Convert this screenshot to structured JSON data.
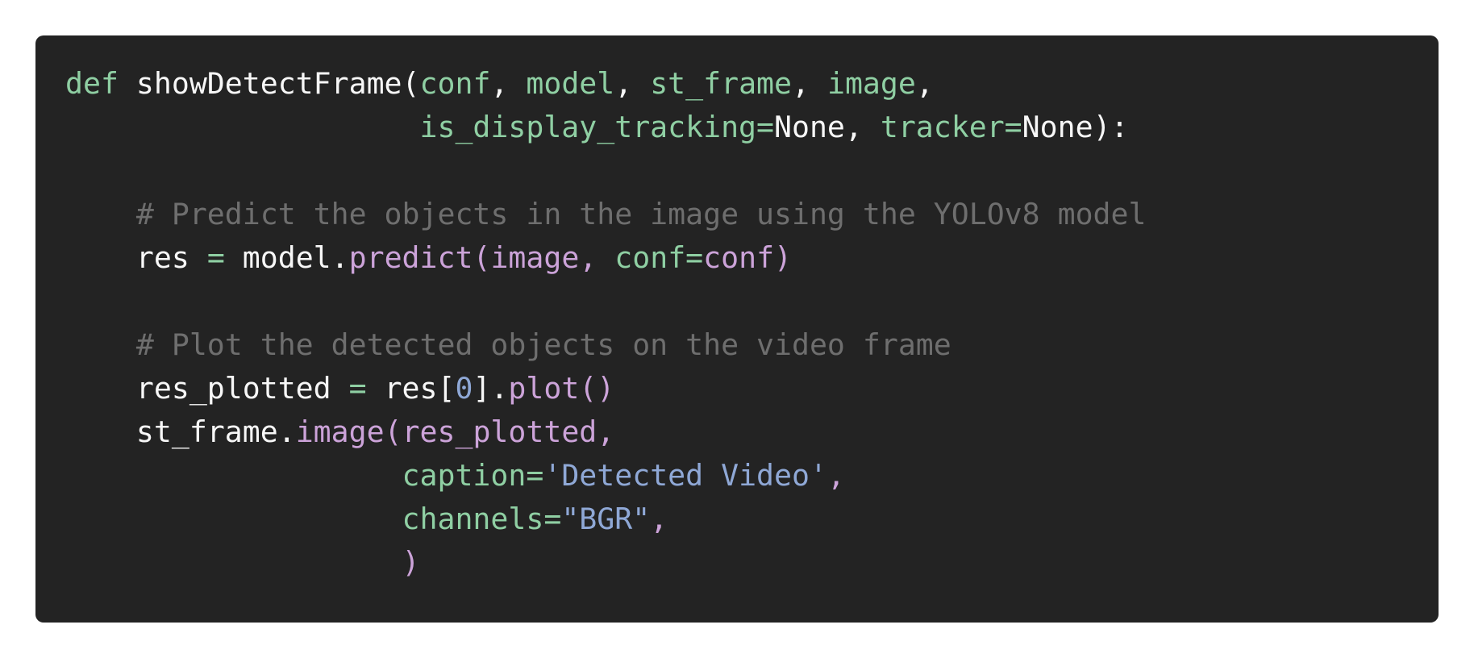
{
  "code": {
    "language": "python",
    "colors": {
      "background": "#232323",
      "keyword": "#8fcfa3",
      "plain": "#f7f7f7",
      "comment": "#6e6e6e",
      "call": "#cca3d9",
      "literal": "#8fa8d6"
    },
    "lines": [
      [
        {
          "t": "def",
          "c": "kw"
        },
        {
          "t": " showDetectFrame(",
          "c": "plain"
        },
        {
          "t": "conf",
          "c": "param"
        },
        {
          "t": ", ",
          "c": "plain"
        },
        {
          "t": "model",
          "c": "param"
        },
        {
          "t": ", ",
          "c": "plain"
        },
        {
          "t": "st_frame",
          "c": "param"
        },
        {
          "t": ", ",
          "c": "plain"
        },
        {
          "t": "image",
          "c": "param"
        },
        {
          "t": ",",
          "c": "plain"
        }
      ],
      [
        {
          "t": "                    ",
          "c": "plain"
        },
        {
          "t": "is_display_tracking=",
          "c": "param"
        },
        {
          "t": "None",
          "c": "plain"
        },
        {
          "t": ", ",
          "c": "plain"
        },
        {
          "t": "tracker=",
          "c": "param"
        },
        {
          "t": "None",
          "c": "plain"
        },
        {
          "t": "):",
          "c": "plain"
        }
      ],
      [],
      [
        {
          "t": "    # Predict the objects in the image using the YOLOv8 model",
          "c": "comment"
        }
      ],
      [
        {
          "t": "    res ",
          "c": "plain"
        },
        {
          "t": "=",
          "c": "op"
        },
        {
          "t": " model.",
          "c": "plain"
        },
        {
          "t": "predict(",
          "c": "call"
        },
        {
          "t": "image",
          "c": "call"
        },
        {
          "t": ", ",
          "c": "call"
        },
        {
          "t": "conf=",
          "c": "param"
        },
        {
          "t": "conf)",
          "c": "call"
        }
      ],
      [],
      [
        {
          "t": "    # Plot the detected objects on the video frame",
          "c": "comment"
        }
      ],
      [
        {
          "t": "    res_plotted ",
          "c": "plain"
        },
        {
          "t": "=",
          "c": "op"
        },
        {
          "t": " res[",
          "c": "plain"
        },
        {
          "t": "0",
          "c": "num"
        },
        {
          "t": "].",
          "c": "plain"
        },
        {
          "t": "plot()",
          "c": "call"
        }
      ],
      [
        {
          "t": "    st_frame.",
          "c": "plain"
        },
        {
          "t": "image(",
          "c": "call"
        },
        {
          "t": "res_plotted,",
          "c": "call"
        }
      ],
      [
        {
          "t": "                   ",
          "c": "plain"
        },
        {
          "t": "caption=",
          "c": "param"
        },
        {
          "t": "'Detected Video'",
          "c": "str"
        },
        {
          "t": ",",
          "c": "call"
        }
      ],
      [
        {
          "t": "                   ",
          "c": "plain"
        },
        {
          "t": "channels=",
          "c": "param"
        },
        {
          "t": "\"BGR\"",
          "c": "str"
        },
        {
          "t": ",",
          "c": "call"
        }
      ],
      [
        {
          "t": "                   ",
          "c": "plain"
        },
        {
          "t": ")",
          "c": "call"
        }
      ]
    ]
  }
}
